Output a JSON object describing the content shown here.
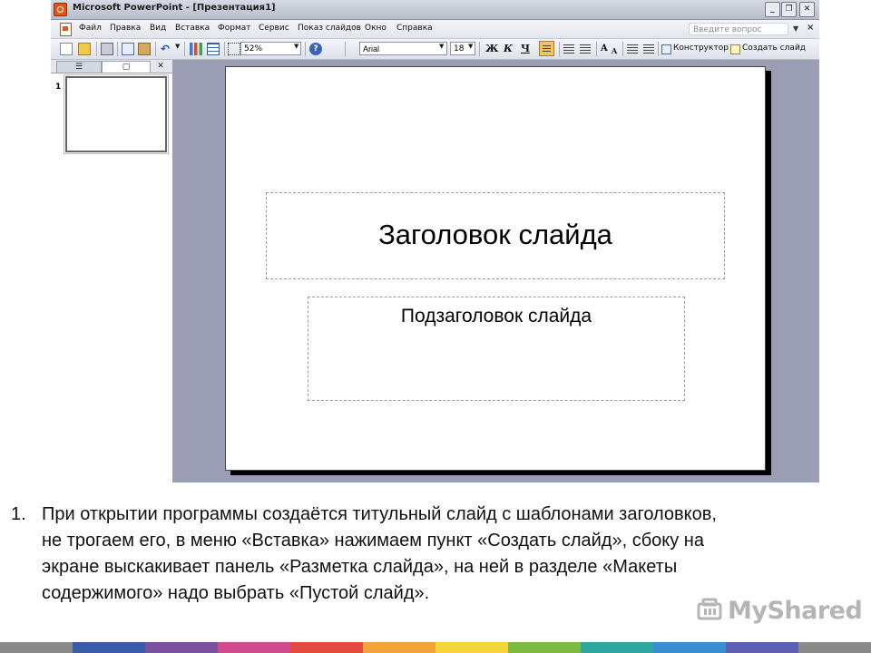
{
  "window": {
    "title": "Microsoft PowerPoint - [Презентация1]",
    "buttons": {
      "minimize": "_",
      "restore": "❐",
      "close": "✕"
    }
  },
  "menubar": {
    "items": [
      "Файл",
      "Правка",
      "Вид",
      "Вставка",
      "Формат",
      "Сервис",
      "Показ слайдов",
      "Окно",
      "Справка"
    ],
    "help_placeholder": "Введите вопрос",
    "close_doc": "×"
  },
  "toolbar": {
    "zoom": "52%",
    "font": "Arial",
    "font_size": "18",
    "bold": "Ж",
    "italic": "К",
    "underline": "Ч",
    "help": "?",
    "designer_label": "Конструктор",
    "new_slide_label": "Создать слайд"
  },
  "left_pane": {
    "tab_close": "✕",
    "slide_number": "1"
  },
  "slide": {
    "title": "Заголовок слайда",
    "subtitle": "Подзаголовок слайда"
  },
  "caption": {
    "number": "1.",
    "lines": [
      "При открытии программы создаётся титульный слайд с шаблонами заголовков,",
      "не трогаем его, в меню «Вставка» нажимаем пункт «Создать слайд», сбоку на",
      "экране выскакивает панель «Разметка слайда», на ней в разделе «Макеты",
      "содержимого» надо выбрать «Пустой слайд»."
    ]
  },
  "watermark": {
    "text": "MyShared"
  },
  "colors": {
    "workspace": "#9a9db3",
    "stripe": [
      "#8a8a8a",
      "#3b5ba9",
      "#7b4fa0",
      "#d14a8b",
      "#e24b3b",
      "#f2a33a",
      "#f5d33a",
      "#7dbb42",
      "#2fa7a0",
      "#3b8fd1",
      "#5c5fb0",
      "#8a8a8a"
    ]
  }
}
